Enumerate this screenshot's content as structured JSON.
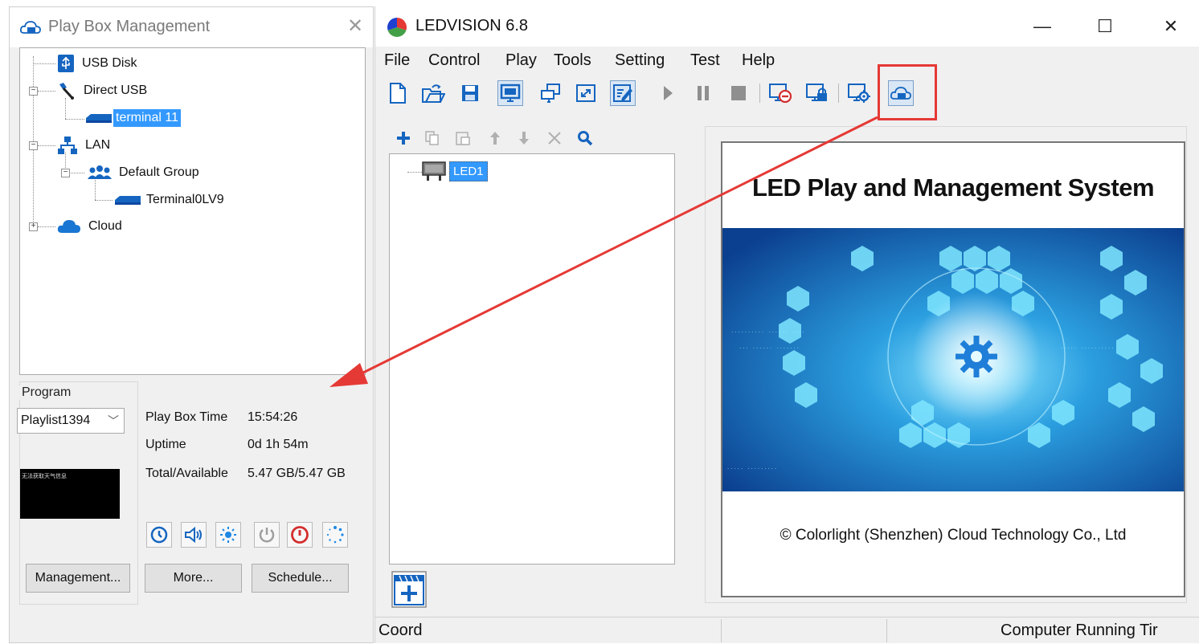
{
  "play_box": {
    "title": "Play Box Management",
    "close_icon": "close-icon",
    "tree": [
      {
        "label": "USB Disk",
        "icon": "usb-icon"
      },
      {
        "label": "Direct USB",
        "icon": "usb-plug-icon"
      },
      {
        "label": "terminal 11",
        "icon": "terminal-icon",
        "selected": true
      },
      {
        "label": "LAN",
        "icon": "network-icon"
      },
      {
        "label": "Default Group",
        "icon": "group-icon"
      },
      {
        "label": "Terminal0LV9",
        "icon": "terminal-icon"
      },
      {
        "label": "Cloud",
        "icon": "cloud-icon"
      }
    ],
    "program": {
      "legend": "Program",
      "selected": "Playlist1394",
      "preview_text": "无法获取天气信息"
    },
    "info": {
      "play_box_time_label": "Play Box Time",
      "play_box_time": "15:54:26",
      "uptime_label": "Uptime",
      "uptime": "0d 1h 54m",
      "total_label": "Total/Availablе",
      "total": "5.47 GB/5.47 GB"
    },
    "controls": [
      "clock-icon",
      "volume-icon",
      "brightness-icon",
      "power-icon",
      "power-off-icon",
      "loading-icon"
    ],
    "buttons": {
      "management": "Management...",
      "more": "More...",
      "schedule": "Schedule..."
    }
  },
  "ledvision": {
    "title": "LEDVISION 6.8",
    "window_controls": {
      "minimize": "—",
      "maximize": "☐",
      "close": "✕"
    },
    "menu": [
      "File",
      "Control",
      "Play",
      "Tools",
      "Setting",
      "Test",
      "Help"
    ],
    "toolbar": [
      "new-file-icon",
      "open-icon",
      "save-icon",
      "screen-icon",
      "window-icon",
      "fullscreen-icon",
      "edit-icon",
      "play-icon",
      "pause-icon",
      "stop-icon",
      "close-screen-icon",
      "lock-screen-icon",
      "screen-settings-icon",
      "cloud-box-icon"
    ],
    "screen_toolbar": [
      "add-icon",
      "copy-icon",
      "paste-icon",
      "up-icon",
      "down-icon",
      "delete-icon",
      "search-icon"
    ],
    "screen_item": "LED1",
    "splash": {
      "title": "LED Play and Management System",
      "copyright": "© Colorlight (Shenzhen) Cloud Technology Co., Ltd"
    },
    "status": {
      "coord": "Coord",
      "running": "Computer Running Tir"
    }
  },
  "colors": {
    "selection": "#3399ff",
    "annotation": "#e53935",
    "accent_blue": "#1565c0"
  }
}
